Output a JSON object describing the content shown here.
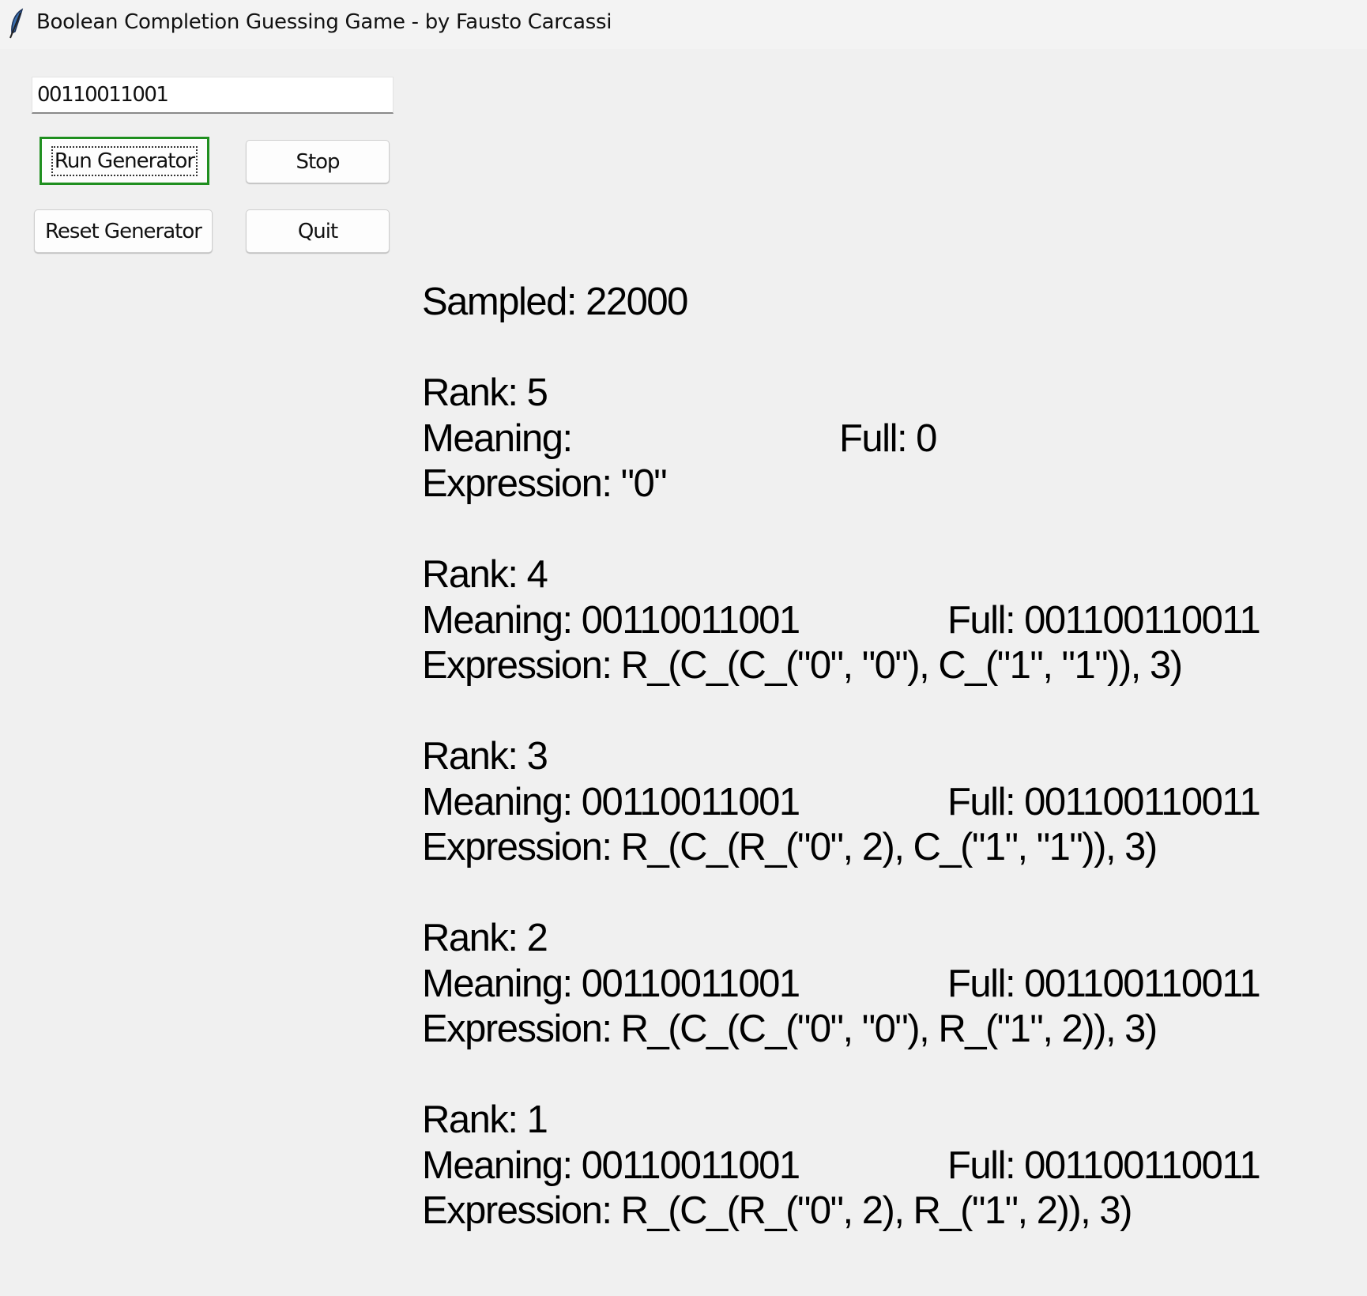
{
  "window": {
    "title": "Boolean Completion Guessing Game - by Fausto Carcassi",
    "icon": "feather-icon"
  },
  "input": {
    "value": "00110011001"
  },
  "buttons": {
    "run": "Run Generator",
    "stop": "Stop",
    "reset": "Reset Generator",
    "quit": "Quit"
  },
  "output": {
    "sampled": "Sampled: 22000",
    "results": [
      {
        "rank": "Rank: 5",
        "meaning": "Meaning: ",
        "full": "Full: 0",
        "expression": "Expression: \"0\""
      },
      {
        "rank": "Rank: 4",
        "meaning": "Meaning: 00110011001",
        "full": "Full: 001100110011",
        "expression": "Expression: R_(C_(C_(\"0\", \"0\"), C_(\"1\", \"1\")), 3)"
      },
      {
        "rank": "Rank: 3",
        "meaning": "Meaning: 00110011001",
        "full": "Full: 001100110011",
        "expression": "Expression: R_(C_(R_(\"0\", 2), C_(\"1\", \"1\")), 3)"
      },
      {
        "rank": "Rank: 2",
        "meaning": "Meaning: 00110011001",
        "full": "Full: 001100110011",
        "expression": "Expression: R_(C_(C_(\"0\", \"0\"), R_(\"1\", 2)), 3)"
      },
      {
        "rank": "Rank: 1",
        "meaning": "Meaning: 00110011001",
        "full": "Full: 001100110011",
        "expression": "Expression: R_(C_(R_(\"0\", 2), R_(\"1\", 2)), 3)"
      }
    ]
  }
}
